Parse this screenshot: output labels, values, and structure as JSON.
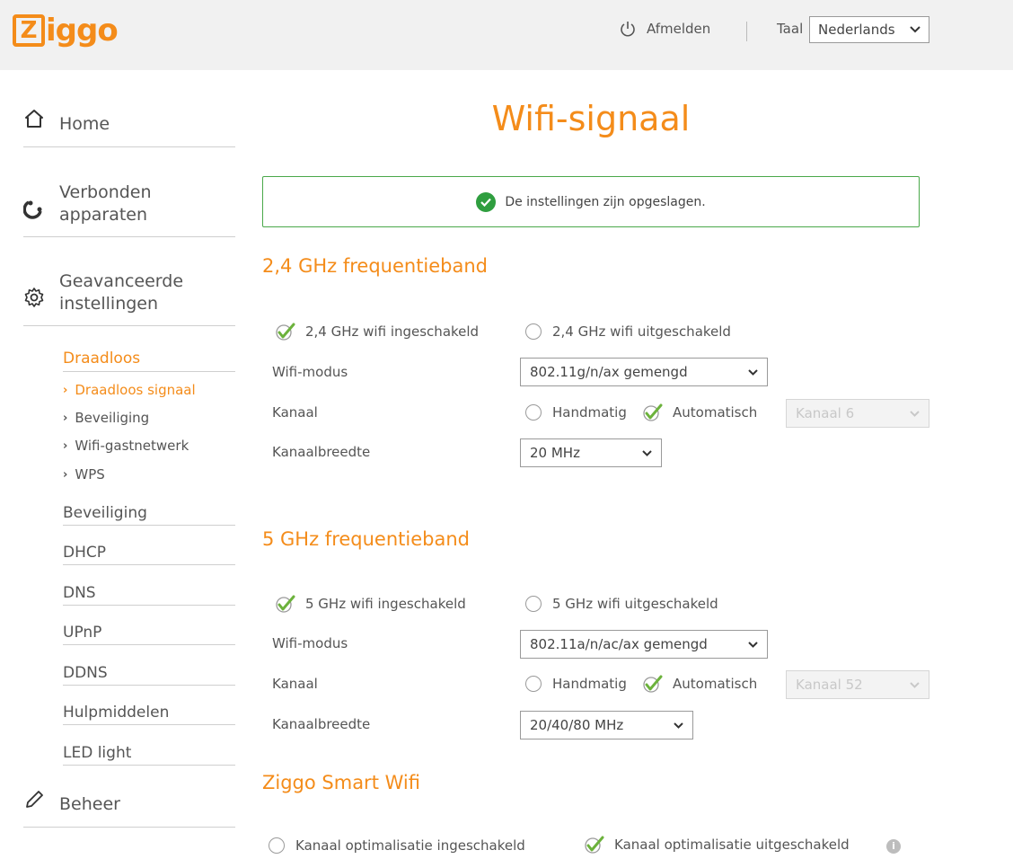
{
  "header": {
    "logo_first": "Z",
    "logo_rest": "iggo",
    "logout_label": "Afmelden",
    "language_label": "Taal",
    "language_value": "Nederlands"
  },
  "sidebar": {
    "main_items": [
      {
        "label": "Home",
        "icon": "home-icon"
      },
      {
        "label_line1": "Verbonden",
        "label_line2": "apparaten",
        "icon": "devices-icon"
      },
      {
        "label_line1": "Geavanceerde",
        "label_line2": "instellingen",
        "icon": "gear-icon"
      },
      {
        "label": "Beheer",
        "icon": "pencil-icon"
      }
    ],
    "subsection_title": "Draadloos",
    "subsection_items": [
      "Draadloos signaal",
      "Beveiliging",
      "Wifi-gastnetwerk",
      "WPS"
    ],
    "advanced_items": [
      "Beveiliging",
      "DHCP",
      "DNS",
      "UPnP",
      "DDNS",
      "Hulpmiddelen",
      "LED light"
    ]
  },
  "main": {
    "title": "Wifi-signaal",
    "notice": "De instellingen zijn opgeslagen.",
    "band24": {
      "title": "2,4 GHz frequentieband",
      "enabled_label": "2,4 GHz wifi ingeschakeld",
      "disabled_label": "2,4 GHz wifi uitgeschakeld",
      "mode_label": "Wifi-modus",
      "mode_value": "802.11g/n/ax gemengd",
      "channel_label": "Kanaal",
      "manual_label": "Handmatig",
      "auto_label": "Automatisch",
      "channel_value": "Kanaal 6",
      "width_label": "Kanaalbreedte",
      "width_value": "20 MHz"
    },
    "band5": {
      "title": "5 GHz frequentieband",
      "enabled_label": "5 GHz wifi ingeschakeld",
      "disabled_label": "5 GHz wifi uitgeschakeld",
      "mode_label": "Wifi-modus",
      "mode_value": "802.11a/n/ac/ax gemengd",
      "channel_label": "Kanaal",
      "manual_label": "Handmatig",
      "auto_label": "Automatisch",
      "channel_value": "Kanaal 52",
      "width_label": "Kanaalbreedte",
      "width_value": "20/40/80 MHz"
    },
    "smart": {
      "title": "Ziggo Smart Wifi",
      "on_label": "Kanaal optimalisatie ingeschakeld",
      "off_label": "Kanaal optimalisatie uitgeschakeld",
      "info_glyph": "i"
    }
  },
  "colors": {
    "accent": "#f48c1a",
    "success": "#2f9e3f",
    "tick": "#6cb23c"
  }
}
